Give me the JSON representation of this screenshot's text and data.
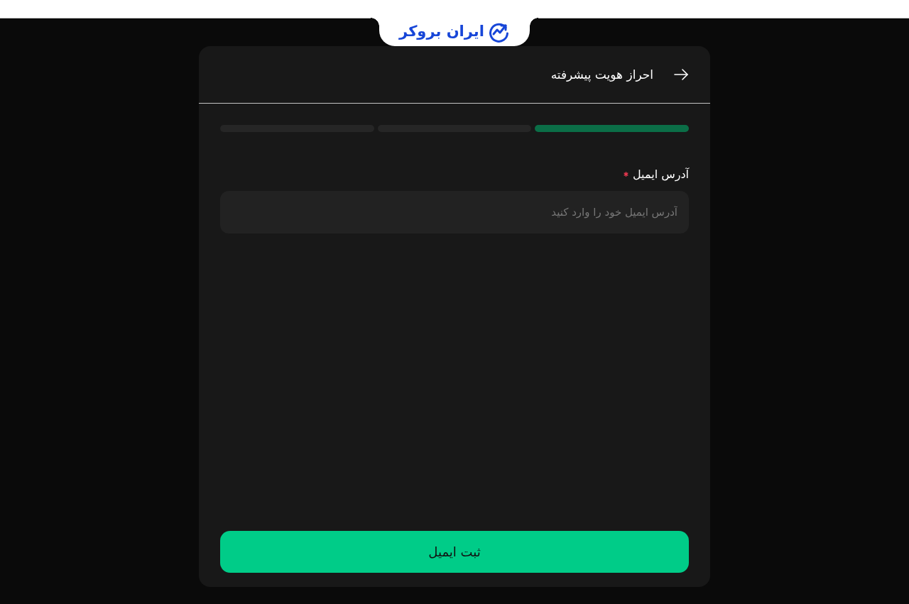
{
  "logo": {
    "text": "ایران بروکر"
  },
  "card": {
    "title": "احراز هویت پیشرفته",
    "steps": [
      {
        "active": true
      },
      {
        "active": false
      },
      {
        "active": false
      }
    ],
    "email_field": {
      "label": "آدرس ایمیل",
      "required": true,
      "placeholder": "آدرس ایمیل خود را وارد کنید"
    },
    "submit_button": {
      "label": "ثبت ایمیل"
    }
  }
}
